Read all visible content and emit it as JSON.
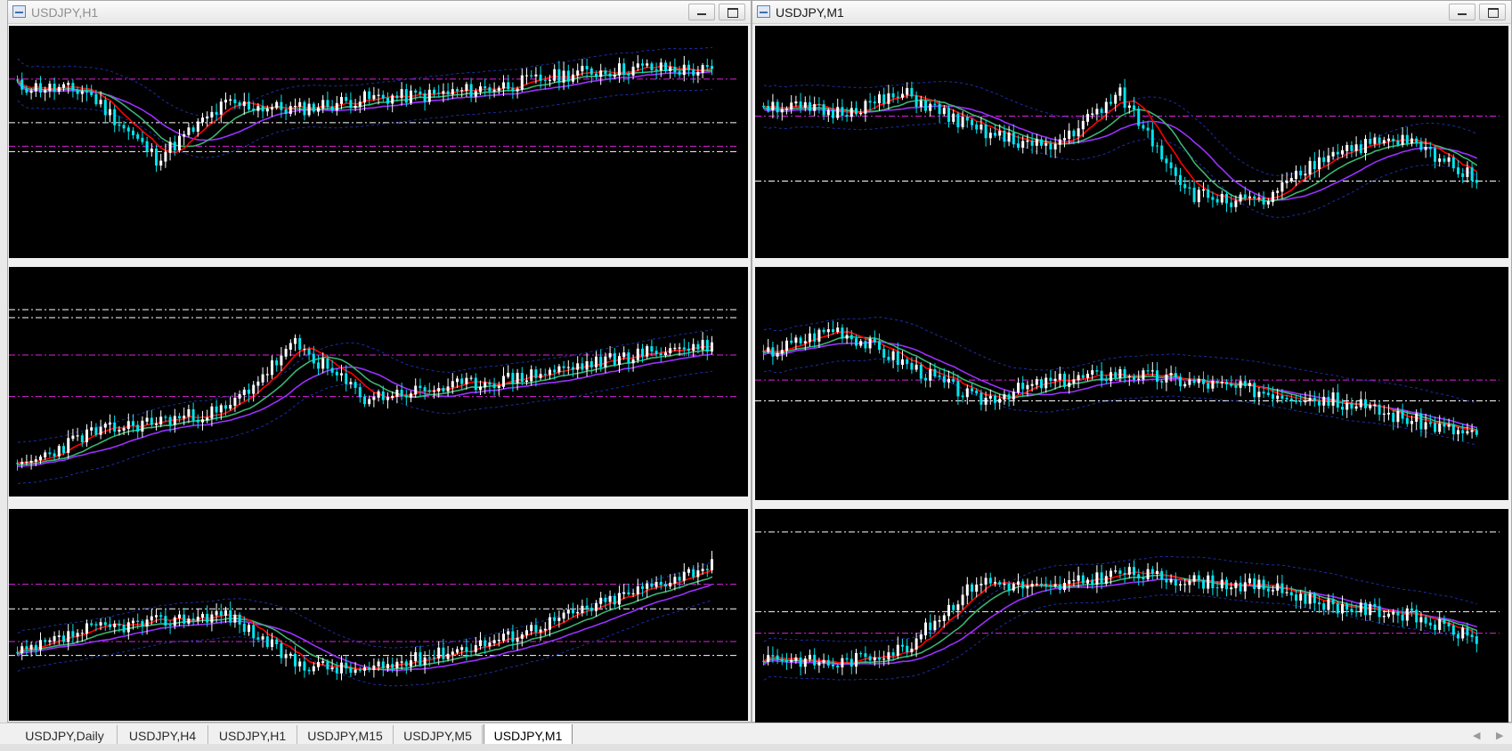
{
  "windows": [
    {
      "title": "USDJPY,H1",
      "active": false
    },
    {
      "title": "USDJPY,M1",
      "active": true
    }
  ],
  "tabs": [
    "USDJPY,Daily",
    "USDJPY,H4",
    "USDJPY,H1",
    "USDJPY,M15",
    "USDJPY,M5",
    "USDJPY,M1"
  ],
  "active_tab": "USDJPY,M1",
  "colors": {
    "background": "#000000",
    "bull_candle": "#ffffff",
    "bear_candle": "#00e5ee",
    "ma_fast": "#ff0000",
    "ma_mid": "#3cb371",
    "ma_slow": "#9b30ff",
    "band": "#1c2ea8",
    "level_white": "#ffffff",
    "level_magenta": "#e020e0"
  }
}
